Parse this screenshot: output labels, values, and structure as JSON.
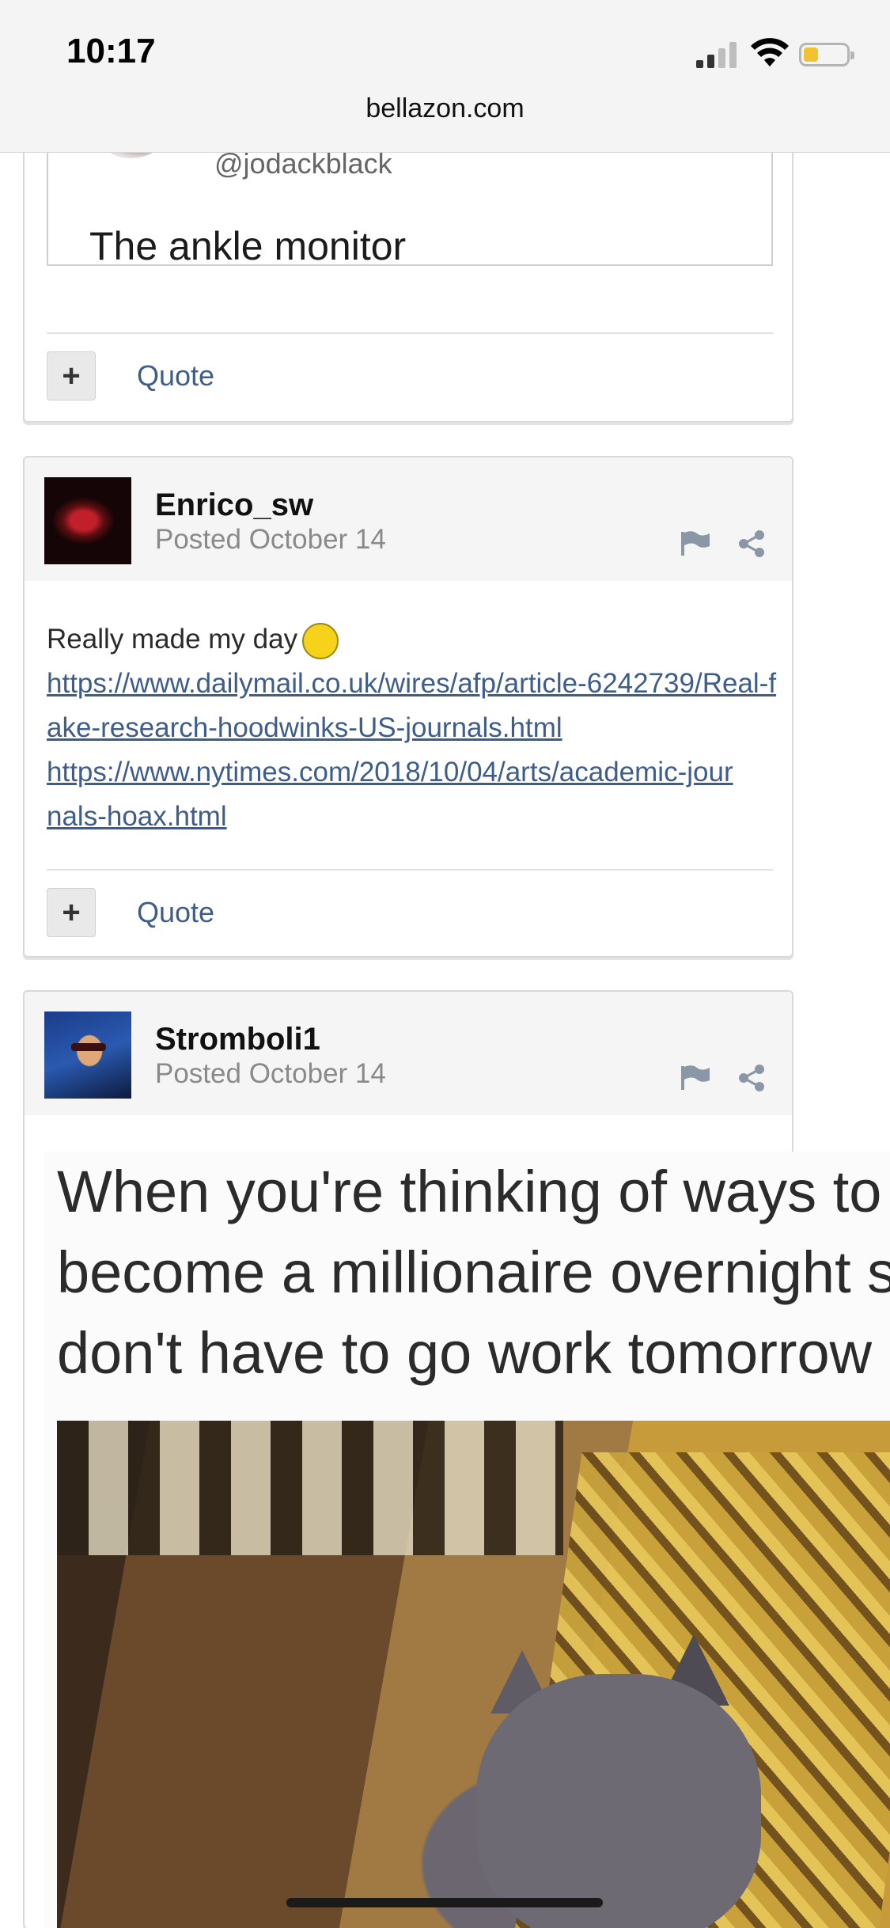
{
  "status_bar": {
    "time": "10:17",
    "battery_level": 0.35
  },
  "browser": {
    "url": "bellazon.com"
  },
  "previous_post": {
    "tweet_handle": "@jodackblack",
    "tweet_text": "The ankle monitor",
    "plus_label": "+",
    "quote_label": "Quote"
  },
  "posts": [
    {
      "username": "Enrico_sw",
      "posted": "Posted October 14",
      "body_text": "Really made my day",
      "links": [
        "https://www.dailymail.co.uk/wires/afp/article-6242739/Real-fake-research-hoodwinks-US-journals.html",
        "https://www.nytimes.com/2018/10/04/arts/academic-journals-hoax.html"
      ],
      "plus_label": "+",
      "quote_label": "Quote"
    },
    {
      "username": "Stromboli1",
      "posted": "Posted October 14",
      "meme_caption": [
        "When you're thinking of ways to",
        "become a millionaire overnight s",
        "don't have to go work tomorrow"
      ]
    }
  ],
  "colors": {
    "link": "#3f5d8a",
    "battery": "#f1c232",
    "header_bg": "#f5f5f5"
  }
}
